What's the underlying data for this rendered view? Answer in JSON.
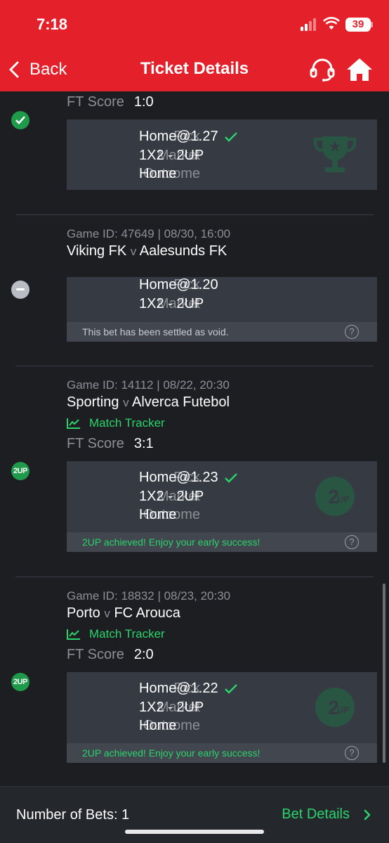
{
  "status_bar": {
    "time": "7:18",
    "battery": "39"
  },
  "header": {
    "back_label": "Back",
    "title": "Ticket Details"
  },
  "bets": [
    {
      "status": "won",
      "ft_label": "FT Score",
      "ft_score": "1:0",
      "pick_label": "Pick",
      "pick_value": "Home@1.27",
      "market_label": "Market",
      "market_value": "1X2 - 2UP",
      "outcome_label": "Outcome",
      "outcome_value": "Home"
    },
    {
      "status": "void",
      "game_id": "Game ID: 47649 | 08/30, 16:00",
      "home_team": "Viking FK",
      "vs": "v",
      "away_team": "Aalesunds FK",
      "pick_label": "Pick",
      "pick_value": "Home@1.20",
      "market_label": "Market",
      "market_value": "1X2 - 2UP",
      "message": "This bet has been settled as void."
    },
    {
      "status": "2up",
      "badge": "2UP",
      "game_id": "Game ID: 14112 | 08/22, 20:30",
      "home_team": "Sporting",
      "vs": "v",
      "away_team": "Alverca Futebol",
      "tracker_label": "Match Tracker",
      "ft_label": "FT Score",
      "ft_score": "3:1",
      "pick_label": "Pick",
      "pick_value": "Home@1.23",
      "market_label": "Market",
      "market_value": "1X2 - 2UP",
      "outcome_label": "Outcome",
      "outcome_value": "Home",
      "message": "2UP achieved! Enjoy your early success!"
    },
    {
      "status": "2up",
      "badge": "2UP",
      "game_id": "Game ID: 18832 | 08/23, 20:30",
      "home_team": "Porto",
      "vs": "v",
      "away_team": "FC Arouca",
      "tracker_label": "Match Tracker",
      "ft_label": "FT Score",
      "ft_score": "2:0",
      "pick_label": "Pick",
      "pick_value": "Home@1.22",
      "market_label": "Market",
      "market_value": "1X2 - 2UP",
      "outcome_label": "Outcome",
      "outcome_value": "Home",
      "message": "2UP achieved! Enjoy your early success!"
    }
  ],
  "help_symbol": "?",
  "footer": {
    "bets_count": "Number of Bets: 1",
    "details_label": "Bet Details"
  },
  "colors": {
    "header_red": "#e4202a",
    "accent_green": "#2bd46b",
    "background": "#1c1e22",
    "card": "#363a42"
  }
}
